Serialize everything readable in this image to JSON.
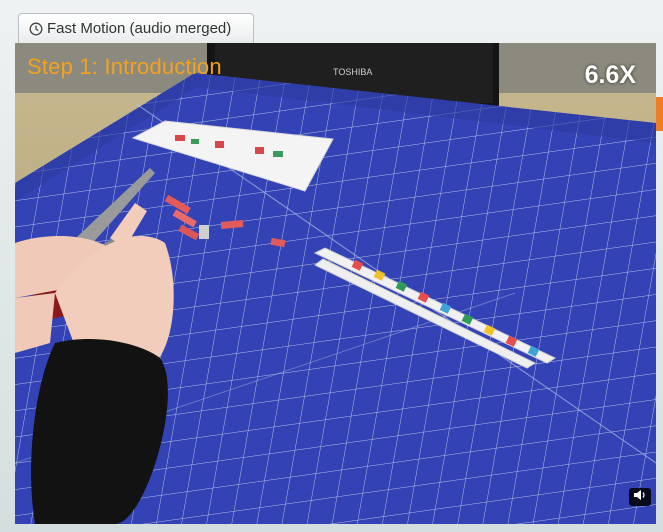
{
  "tab": {
    "icon": "clock-icon",
    "label": "Fast Motion (audio merged)"
  },
  "video": {
    "step_title": "Step 1: Introduction",
    "speed_label": "6.6X",
    "monitor_brand": "TOSHIBA",
    "volume_icon": "speaker-icon"
  },
  "colors": {
    "accent_orange": "#f3a21c",
    "mat_blue": "#3040b8",
    "next_arrow": "#ef7d23"
  }
}
